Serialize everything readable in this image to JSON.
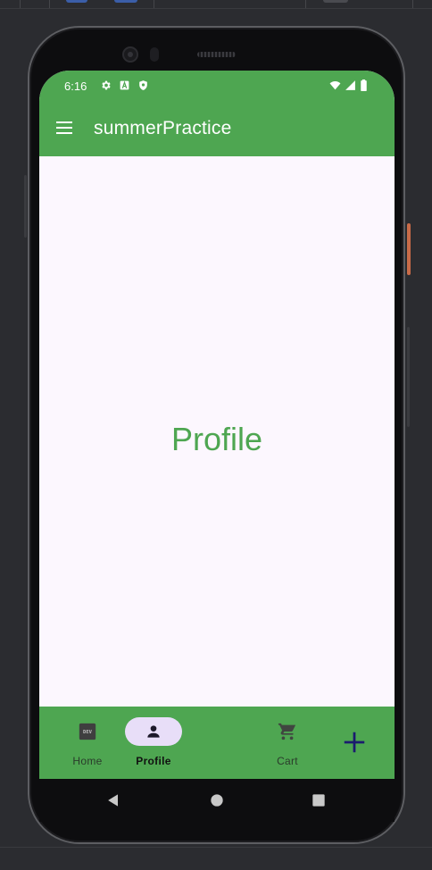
{
  "status_bar": {
    "time": "6:16",
    "left_icons": [
      "settings-icon",
      "a-badge-icon",
      "shield-icon"
    ],
    "right_icons": [
      "wifi-icon",
      "signal-icon",
      "battery-icon"
    ]
  },
  "app_bar": {
    "title": "summerPractice",
    "menu_icon": "menu-icon"
  },
  "content": {
    "screen_label": "Profile"
  },
  "bottom_nav": {
    "items": [
      {
        "label": "Home",
        "icon": "dev-icon",
        "selected": false
      },
      {
        "label": "Profile",
        "icon": "person-icon",
        "selected": true
      },
      {
        "label": "Cart",
        "icon": "cart-icon",
        "selected": false
      }
    ],
    "add_icon": "plus-icon"
  },
  "colors": {
    "primary_green": "#4ea651",
    "surface": "#fcf7fe",
    "selected_pill": "#e8def8",
    "add_icon": "#1b1b6e"
  },
  "system_nav": [
    "back-icon",
    "home-circle-icon",
    "recents-icon"
  ]
}
